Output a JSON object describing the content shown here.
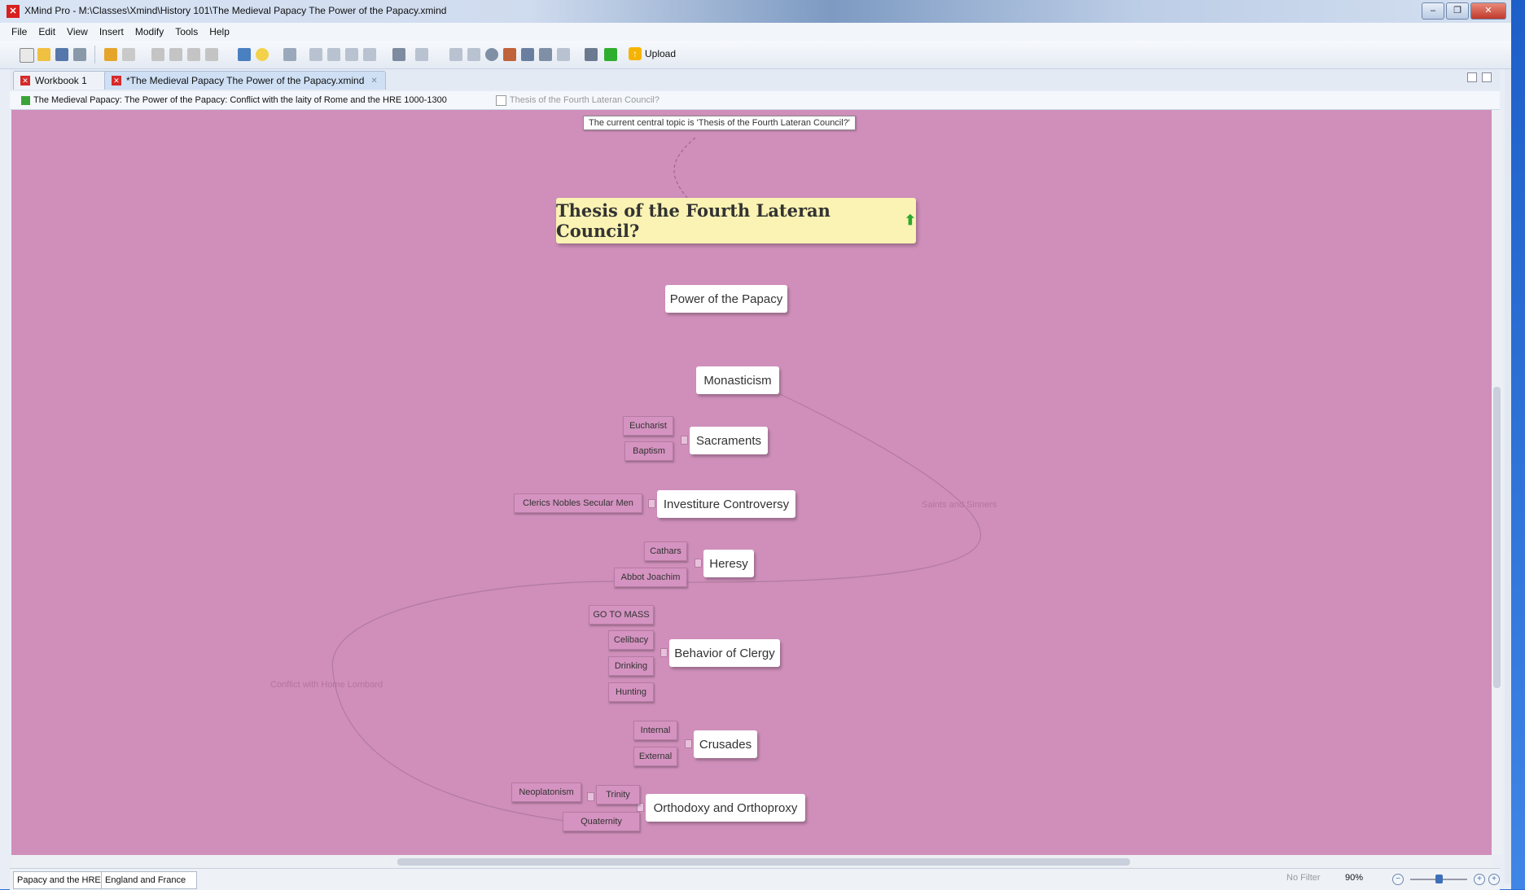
{
  "window": {
    "title": "XMind Pro - M:\\Classes\\Xmind\\History 101\\The Medieval Papacy  The Power of the Papacy.xmind",
    "controls": [
      "–",
      "❐",
      "✕"
    ]
  },
  "menu": [
    "File",
    "Edit",
    "View",
    "Insert",
    "Modify",
    "Tools",
    "Help"
  ],
  "toolbar": {
    "upload_label": "Upload"
  },
  "tabs": [
    {
      "label": "Workbook 1"
    },
    {
      "label": "*The Medieval Papacy  The Power of the Papacy.xmind"
    }
  ],
  "breadcrumb": {
    "path": "The Medieval Papacy: The Power of the Papacy: Conflict with the laity of Rome and the HRE 1000-1300",
    "current": "Thesis of the Fourth Lateran Council?"
  },
  "map": {
    "callout": "The current central topic is 'Thesis of the Fourth Lateran Council?'",
    "central": "Thesis of the Fourth Lateran Council?",
    "topics": [
      {
        "label": "Power of the Papacy",
        "subs": []
      },
      {
        "label": "Monasticism",
        "subs": []
      },
      {
        "label": "Sacraments",
        "subs": [
          "Eucharist",
          "Baptism"
        ]
      },
      {
        "label": "Investiture Controversy",
        "subs": [
          "Clerics Nobles Secular Men"
        ]
      },
      {
        "label": "Heresy",
        "subs": [
          "Cathars",
          "Abbot Joachim"
        ]
      },
      {
        "label": "Behavior of Clergy",
        "subs": [
          "GO TO MASS",
          "Celibacy",
          "Drinking",
          "Hunting"
        ]
      },
      {
        "label": "Crusades",
        "subs": [
          "Internal",
          "External"
        ]
      },
      {
        "label": "Orthodoxy and Orthoproxy",
        "subs": [
          "Trinity",
          "Quaternity"
        ],
        "subsub": "Neoplatonism"
      }
    ],
    "relationships": [
      "Saints and Sinners",
      "Conflict with Home Lombard"
    ]
  },
  "status": {
    "sheets": [
      "Papacy and the HRE",
      "England and France"
    ],
    "filter": "No Filter",
    "zoom": "90%"
  },
  "colors": {
    "canvas": "#cf8fba",
    "central_fill": "#fbf3b3",
    "subtopic_fill": "#d493c0"
  }
}
